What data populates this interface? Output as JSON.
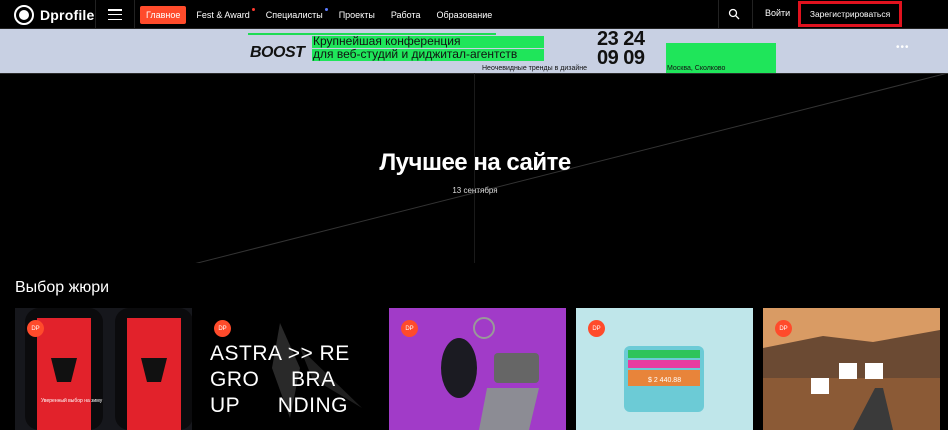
{
  "header": {
    "logo_text": "Dprofile",
    "nav": [
      {
        "label": "Главное",
        "active": true,
        "dot": ""
      },
      {
        "label": "Fest & Award",
        "active": false,
        "dot": "red"
      },
      {
        "label": "Специалисты",
        "active": false,
        "dot": "blue"
      },
      {
        "label": "Проекты",
        "active": false,
        "dot": ""
      },
      {
        "label": "Работа",
        "active": false,
        "dot": ""
      },
      {
        "label": "Образование",
        "active": false,
        "dot": ""
      }
    ],
    "login_label": "Войти",
    "register_label": "Зарегистрироваться",
    "accent_color": "#ff4b2b",
    "highlight_color": "#e0121e"
  },
  "banner": {
    "brand": "BOOST",
    "title_line1": "Крупнейшая конференция",
    "title_line2": "для веб-студий и диджитал-агентств",
    "subtitle": "Неочевидные тренды в дизайне",
    "dates_line1": "23 24",
    "dates_line2": "09 09",
    "location": "Москва, Сколково",
    "more_icon": "more-dots-icon",
    "bg_color": "#c8d0e3",
    "green_color": "#1fe55a"
  },
  "hero": {
    "title": "Лучшее на сайте",
    "date": "13 сентября"
  },
  "section": {
    "title": "Выбор жюри",
    "cards": [
      {
        "badge": "DP",
        "caption": "Уверенный выбор на зиму"
      },
      {
        "badge": "DP",
        "caption": "ASTRA >> RE\nGRO     BRA\nUP      NDING"
      },
      {
        "badge": "DP",
        "caption": ""
      },
      {
        "badge": "DP",
        "caption": "$ 2 440.88"
      },
      {
        "badge": "DP",
        "caption": ""
      }
    ]
  }
}
